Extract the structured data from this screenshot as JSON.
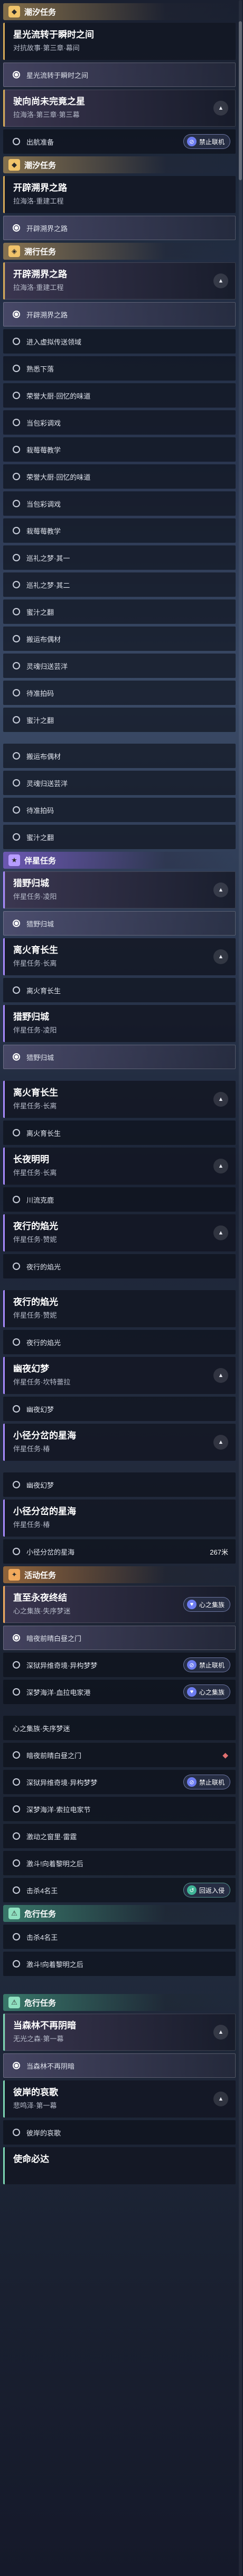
{
  "sections": [
    {
      "title": "潮汐任务"
    },
    {
      "title": "溯行任务"
    },
    {
      "title": "伴星任务"
    },
    {
      "title": "活动任务"
    },
    {
      "title": "危行任务"
    }
  ],
  "quests": [
    {
      "title": "星光流转于瞬时之间",
      "sub": "对抗故事·第三章·幕间"
    },
    {
      "title": "驶向尚未完竟之星",
      "sub": "拉海洛·第三章·第三幕"
    },
    {
      "title": "开辟溯界之路",
      "sub": "拉海洛·重建工程"
    },
    {
      "title": "开辟溯界之路",
      "sub": "拉海洛·重建工程"
    },
    {
      "title": "猎野归城",
      "sub": "伴星任务·凌阳"
    },
    {
      "title": "离火育长生",
      "sub": "伴星任务·长离"
    },
    {
      "title": "长夜明明",
      "sub": "伴星任务·长离"
    },
    {
      "title": "夜行的焰光",
      "sub": "伴星任务·赞妮"
    },
    {
      "title": "幽夜幻梦",
      "sub": "伴星任务·坎特蕾拉"
    },
    {
      "title": "小径分岔的星海",
      "sub": "伴星任务·椿"
    },
    {
      "title": "直至永夜终结",
      "sub": "心之集族·失序梦迷"
    },
    {
      "title": "当森林不再阴暗",
      "sub": "无光之森·第一幕"
    },
    {
      "title": "彼岸的哀歌",
      "sub": "悲鸣泽·第一幕"
    },
    {
      "title": "使命必达"
    }
  ],
  "steps": [
    "星光流转于瞬时之间",
    "出航准备",
    "开辟溯界之路",
    "开辟溯界之路",
    "进入虚拟传送领域",
    "熟悉下落",
    "荣誉大厨·回忆的味道",
    "当包彩调戏",
    "栽莓莓教学",
    "荣誉大厨·回忆的味道",
    "当包彩调戏",
    "栽莓莓教学",
    "巡礼之梦·其一",
    "巡礼之梦·其二",
    "蜜汁之翻",
    "搬运布偶材",
    "灵魂归送芸洋",
    "待准拍码",
    "蜜汁之翻",
    "猎野归城",
    "离火育长生",
    "川流克鹿",
    "夜行的焰光",
    "幽夜幻梦",
    "小径分岔的星海",
    "暗夜前晴白昼之门",
    "深狱异维奇境·异构梦梦",
    "深梦海洋·血拉电家港",
    "深狱异维奇境·异构梦梦",
    "深梦海洋·索拉电家节",
    "激动之窗里·雷霆",
    "激斗!向着黎明之后",
    "击杀4名王",
    "当森林不再阴暗",
    "彼岸的哀歌"
  ],
  "badges": {
    "forbid_mount": "禁止联机",
    "heart_collection": "心之集族",
    "return_portal": "回返入侵"
  },
  "distances": [
    "267米"
  ]
}
